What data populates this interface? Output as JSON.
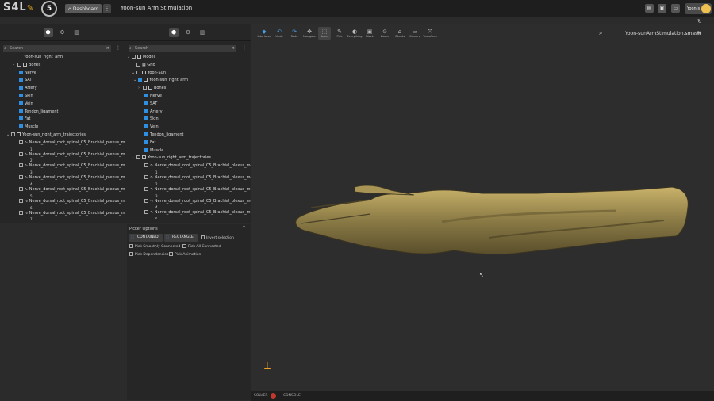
{
  "topbar": {
    "logo": "S4L",
    "s5": "5",
    "dashboard_label": "Dashboard",
    "title": "Yoon-sun Arm Stimulation",
    "user_label": "Yoon-s"
  },
  "left_panel": {
    "search_placeholder": "Search",
    "rows": [
      {
        "text": "Yoon-sun_right_arm",
        "kind": "hidden"
      },
      {
        "text": "Bones",
        "kind": "folder",
        "arrow": "›"
      },
      {
        "text": "Nerve",
        "kind": "blue"
      },
      {
        "text": "SAT",
        "kind": "blue"
      },
      {
        "text": "Artery",
        "kind": "blue"
      },
      {
        "text": "Skin",
        "kind": "blue"
      },
      {
        "text": "Vein",
        "kind": "blue"
      },
      {
        "text": "Tendon_ligament",
        "kind": "blue"
      },
      {
        "text": "Fat",
        "kind": "blue"
      },
      {
        "text": "Muscle",
        "kind": "blue"
      },
      {
        "text": "Yoon-sun_right_arm_trajectories",
        "kind": "folder",
        "arrow": "⌄"
      },
      {
        "text": "Nerve_dorsal_root_spinal_C5_Brachial_plexus_med",
        "kind": "traj",
        "sub": "1"
      },
      {
        "text": "Nerve_dorsal_root_spinal_C5_Brachial_plexus_med",
        "kind": "traj",
        "sub": "2"
      },
      {
        "text": "Nerve_dorsal_root_spinal_C5_Brachial_plexus_med",
        "kind": "traj",
        "sub": "3"
      },
      {
        "text": "Nerve_dorsal_root_spinal_C5_Brachial_plexus_med",
        "kind": "traj",
        "sub": "4"
      },
      {
        "text": "Nerve_dorsal_root_spinal_C5_Brachial_plexus_med",
        "kind": "traj",
        "sub": "5"
      },
      {
        "text": "Nerve_dorsal_root_spinal_C5_Brachial_plexus_med",
        "kind": "traj",
        "sub": "6"
      },
      {
        "text": "Nerve_dorsal_root_spinal_C5_Brachial_plexus_med",
        "kind": "traj",
        "sub": "7"
      }
    ]
  },
  "mid_panel": {
    "search_placeholder": "Search",
    "rows": [
      {
        "text": "Model",
        "kind": "root",
        "arrow": "⌄"
      },
      {
        "text": "Grid",
        "kind": "grid"
      },
      {
        "text": "Yoon-Sun",
        "kind": "folder",
        "arrow": "⌄"
      },
      {
        "text": "Yoon-sun_right_arm",
        "kind": "folderblue",
        "arrow": "⌄"
      },
      {
        "text": "Bones",
        "kind": "folder",
        "arrow": "›"
      },
      {
        "text": "Nerve",
        "kind": "blue"
      },
      {
        "text": "SAT",
        "kind": "blue"
      },
      {
        "text": "Artery",
        "kind": "blue"
      },
      {
        "text": "Skin",
        "kind": "blue"
      },
      {
        "text": "Vein",
        "kind": "blue"
      },
      {
        "text": "Tendon_ligament",
        "kind": "blue"
      },
      {
        "text": "Fat",
        "kind": "blue"
      },
      {
        "text": "Muscle",
        "kind": "blue"
      },
      {
        "text": "Yoon-sun_right_arm_trajectories",
        "kind": "folder",
        "arrow": "⌄"
      },
      {
        "text": "Nerve_dorsal_root_spinal_C5_Brachial_plexus_med",
        "kind": "traj",
        "sub": "1"
      },
      {
        "text": "Nerve_dorsal_root_spinal_C5_Brachial_plexus_med",
        "kind": "traj",
        "sub": "2"
      },
      {
        "text": "Nerve_dorsal_root_spinal_C5_Brachial_plexus_med",
        "kind": "traj",
        "sub": "3"
      },
      {
        "text": "Nerve_dorsal_root_spinal_C5_Brachial_plexus_med",
        "kind": "traj",
        "sub": "4"
      },
      {
        "text": "Nerve_dorsal_root_spinal_C5_Brachial_plexus_med",
        "kind": "traj",
        "sub": "5"
      }
    ]
  },
  "picker": {
    "header": "Picker Options",
    "contained": "CONTAINED",
    "rectangle": "RECTANGLE",
    "invert_label": "Invert selection",
    "opt_smooth": "Pick Smoothly Connected",
    "opt_all": "Pick All Connected",
    "opt_dep": "Pick Dependencies",
    "opt_anim": "Pick Animation"
  },
  "viewport": {
    "tools": [
      {
        "label": "Interlayer",
        "glyph": "◆",
        "blue": true
      },
      {
        "label": "Undo",
        "glyph": "↶",
        "blue": true
      },
      {
        "label": "Redo",
        "glyph": "↷",
        "blue": true
      },
      {
        "label": "Navigate",
        "glyph": "✥",
        "blue": false
      },
      {
        "label": "Select",
        "glyph": "⬚",
        "blue": false,
        "on": true
      },
      {
        "label": "Pick",
        "glyph": "✎",
        "blue": false
      },
      {
        "label": "Everything",
        "glyph": "◐",
        "blue": false
      },
      {
        "label": "Block",
        "glyph": "▣",
        "blue": false
      },
      {
        "label": "Zoom",
        "glyph": "⊙",
        "blue": false
      },
      {
        "label": "Clients",
        "glyph": "⌂",
        "blue": false
      },
      {
        "label": "Camera",
        "glyph": "▭",
        "blue": false
      },
      {
        "label": "Transform",
        "glyph": "⤧",
        "blue": false
      }
    ],
    "file_name": "Yoon-sunArmStimulation.smash",
    "bottom_left": "SOLVER",
    "bottom_right": "CONSOLE"
  }
}
